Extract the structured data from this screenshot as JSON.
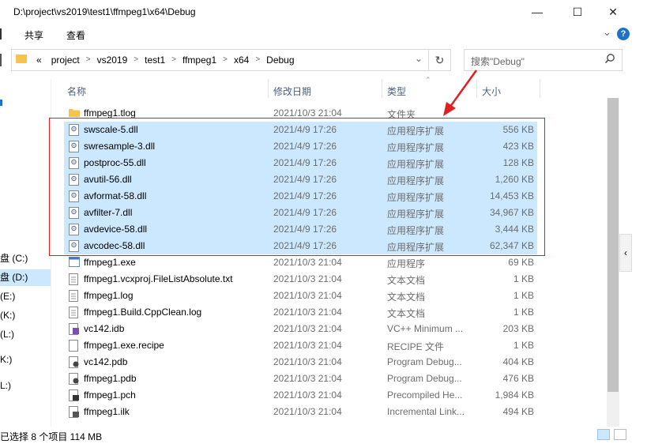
{
  "window": {
    "title": "D:\\project\\vs2019\\test1\\ffmpeg1\\x64\\Debug",
    "minimize": "—",
    "maximize": "☐",
    "close": "✕"
  },
  "ribbon": {
    "tabs": [
      "共享",
      "查看"
    ],
    "expand": "⌄",
    "help": "?"
  },
  "address": {
    "overflow": "«",
    "crumbs": [
      "project",
      "vs2019",
      "test1",
      "ffmpeg1",
      "x64",
      "Debug"
    ],
    "dropdown": "⌄",
    "refresh": "↻"
  },
  "search": {
    "placeholder": "搜索\"Debug\"",
    "icon": "search-icon"
  },
  "nav": {
    "items": [
      "盘 (C:)",
      "盘 (D:)",
      "(E:)",
      "(K:)",
      "(L:)",
      "K:)",
      "L:)"
    ],
    "selected_index": 1
  },
  "columns": {
    "name": "名称",
    "date": "修改日期",
    "type": "类型",
    "size": "大小"
  },
  "files": [
    {
      "name": "ffmpeg1.tlog",
      "date": "2021/10/3 21:04",
      "type": "文件夹",
      "size": "",
      "icon": "folder-icon",
      "selected": false
    },
    {
      "name": "swscale-5.dll",
      "date": "2021/4/9 17:26",
      "type": "应用程序扩展",
      "size": "556 KB",
      "icon": "dll-icon",
      "selected": true
    },
    {
      "name": "swresample-3.dll",
      "date": "2021/4/9 17:26",
      "type": "应用程序扩展",
      "size": "423 KB",
      "icon": "dll-icon",
      "selected": true
    },
    {
      "name": "postproc-55.dll",
      "date": "2021/4/9 17:26",
      "type": "应用程序扩展",
      "size": "128 KB",
      "icon": "dll-icon",
      "selected": true
    },
    {
      "name": "avutil-56.dll",
      "date": "2021/4/9 17:26",
      "type": "应用程序扩展",
      "size": "1,260 KB",
      "icon": "dll-icon",
      "selected": true
    },
    {
      "name": "avformat-58.dll",
      "date": "2021/4/9 17:26",
      "type": "应用程序扩展",
      "size": "14,453 KB",
      "icon": "dll-icon",
      "selected": true
    },
    {
      "name": "avfilter-7.dll",
      "date": "2021/4/9 17:26",
      "type": "应用程序扩展",
      "size": "34,967 KB",
      "icon": "dll-icon",
      "selected": true
    },
    {
      "name": "avdevice-58.dll",
      "date": "2021/4/9 17:26",
      "type": "应用程序扩展",
      "size": "3,444 KB",
      "icon": "dll-icon",
      "selected": true
    },
    {
      "name": "avcodec-58.dll",
      "date": "2021/4/9 17:26",
      "type": "应用程序扩展",
      "size": "62,347 KB",
      "icon": "dll-icon",
      "selected": true
    },
    {
      "name": "ffmpeg1.exe",
      "date": "2021/10/3 21:04",
      "type": "应用程序",
      "size": "69 KB",
      "icon": "exe-icon",
      "selected": false
    },
    {
      "name": "ffmpeg1.vcxproj.FileListAbsolute.txt",
      "date": "2021/10/3 21:04",
      "type": "文本文档",
      "size": "1 KB",
      "icon": "text-file-icon",
      "selected": false
    },
    {
      "name": "ffmpeg1.log",
      "date": "2021/10/3 21:04",
      "type": "文本文档",
      "size": "1 KB",
      "icon": "text-file-icon",
      "selected": false
    },
    {
      "name": "ffmpeg1.Build.CppClean.log",
      "date": "2021/10/3 21:04",
      "type": "文本文档",
      "size": "1 KB",
      "icon": "text-file-icon",
      "selected": false
    },
    {
      "name": "vc142.idb",
      "date": "2021/10/3 21:04",
      "type": "VC++ Minimum ...",
      "size": "203 KB",
      "icon": "idb-file-icon",
      "selected": false
    },
    {
      "name": "ffmpeg1.exe.recipe",
      "date": "2021/10/3 21:04",
      "type": "RECIPE 文件",
      "size": "1 KB",
      "icon": "blank-file-icon",
      "selected": false
    },
    {
      "name": "vc142.pdb",
      "date": "2021/10/3 21:04",
      "type": "Program Debug...",
      "size": "404 KB",
      "icon": "pdb-file-icon",
      "selected": false
    },
    {
      "name": "ffmpeg1.pdb",
      "date": "2021/10/3 21:04",
      "type": "Program Debug...",
      "size": "476 KB",
      "icon": "pdb-file-icon",
      "selected": false
    },
    {
      "name": "ffmpeg1.pch",
      "date": "2021/10/3 21:04",
      "type": "Precompiled He...",
      "size": "1,984 KB",
      "icon": "pch-file-icon",
      "selected": false
    },
    {
      "name": "ffmpeg1.ilk",
      "date": "2021/10/3 21:04",
      "type": "Incremental Link...",
      "size": "494 KB",
      "icon": "ilk-file-icon",
      "selected": false
    }
  ],
  "status": {
    "text": "已选择 8 个项目  114 MB"
  },
  "side_tab": "‹",
  "colors": {
    "selection": "#cce8ff",
    "annotation": "#e02020",
    "folder": "#f6c34b",
    "header_text": "#4c607a"
  }
}
